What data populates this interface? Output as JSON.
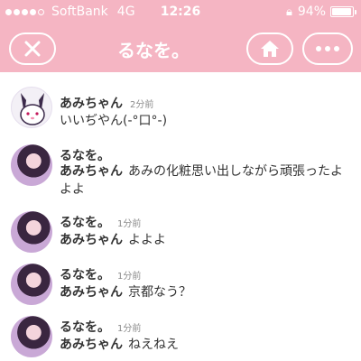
{
  "status_bar": {
    "carrier": "SoftBank",
    "network": "4G",
    "time": "12:26",
    "battery": "94%",
    "battery_level": 0.94
  },
  "nav": {
    "title": "るなを。",
    "close_icon": "close-icon",
    "home_icon": "home-icon",
    "more_icon": "more-icon"
  },
  "feed": [
    {
      "name": "あみちゃん",
      "time": "2分前",
      "sender": "",
      "text": "いいぢやん(-°口°-)"
    },
    {
      "name": "るなを。",
      "time": "",
      "sender": "あみちゃん",
      "text": "あみの化粧思い出しながら頑張ったよよよ"
    },
    {
      "name": "るなを。",
      "time": "1分前",
      "sender": "あみちゃん",
      "text": "よよよ"
    },
    {
      "name": "るなを。",
      "time": "1分前",
      "sender": "あみちゃん",
      "text": "京都なう？"
    },
    {
      "name": "るなを。",
      "time": "1分前",
      "sender": "あみちゃん",
      "text": "ねえねえ"
    }
  ],
  "colors": {
    "header": "#f5b5c3",
    "text": "#333333",
    "muted": "#8a8a8a"
  }
}
